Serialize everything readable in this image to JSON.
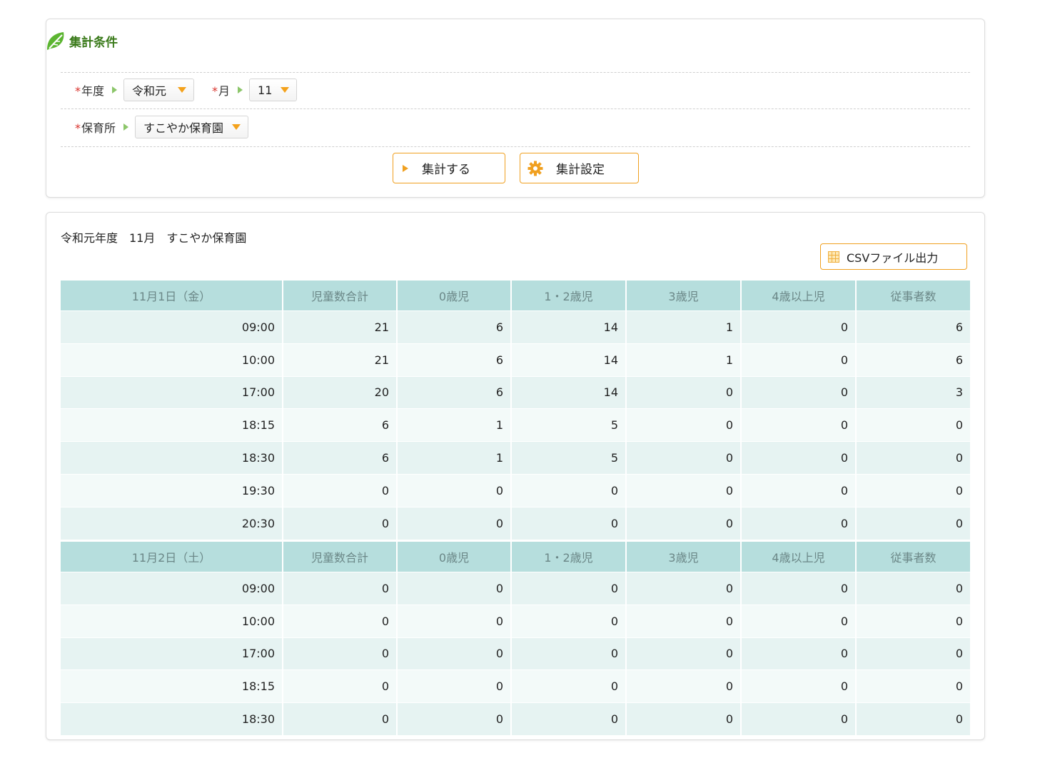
{
  "conditions": {
    "title": "集計条件",
    "year_label": "年度",
    "year_value": "令和元",
    "month_label": "月",
    "month_value": "11",
    "nursery_label": "保育所",
    "nursery_value": "すこやか保育園",
    "required_mark": "*",
    "aggregate_button": "集計する",
    "settings_button": "集計設定"
  },
  "result": {
    "summary": "令和元年度　11月　すこやか保育園",
    "csv_button": "CSVファイル出力",
    "columns": [
      "児童数合計",
      "0歳児",
      "1・2歳児",
      "3歳児",
      "4歳以上児",
      "従事者数"
    ],
    "days": [
      {
        "date": "11月1日（金）",
        "rows": [
          {
            "time": "09:00",
            "values": [
              "21",
              "6",
              "14",
              "1",
              "0",
              "6"
            ]
          },
          {
            "time": "10:00",
            "values": [
              "21",
              "6",
              "14",
              "1",
              "0",
              "6"
            ]
          },
          {
            "time": "17:00",
            "values": [
              "20",
              "6",
              "14",
              "0",
              "0",
              "3"
            ]
          },
          {
            "time": "18:15",
            "values": [
              "6",
              "1",
              "5",
              "0",
              "0",
              "0"
            ]
          },
          {
            "time": "18:30",
            "values": [
              "6",
              "1",
              "5",
              "0",
              "0",
              "0"
            ]
          },
          {
            "time": "19:30",
            "values": [
              "0",
              "0",
              "0",
              "0",
              "0",
              "0"
            ]
          },
          {
            "time": "20:30",
            "values": [
              "0",
              "0",
              "0",
              "0",
              "0",
              "0"
            ]
          }
        ]
      },
      {
        "date": "11月2日（土）",
        "rows": [
          {
            "time": "09:00",
            "values": [
              "0",
              "0",
              "0",
              "0",
              "0",
              "0"
            ]
          },
          {
            "time": "10:00",
            "values": [
              "0",
              "0",
              "0",
              "0",
              "0",
              "0"
            ]
          },
          {
            "time": "17:00",
            "values": [
              "0",
              "0",
              "0",
              "0",
              "0",
              "0"
            ]
          },
          {
            "time": "18:15",
            "values": [
              "0",
              "0",
              "0",
              "0",
              "0",
              "0"
            ]
          },
          {
            "time": "18:30",
            "values": [
              "0",
              "0",
              "0",
              "0",
              "0",
              "0"
            ]
          }
        ]
      }
    ]
  },
  "colors": {
    "header_bg": "#b6dedd",
    "row_odd": "#e6f3f2",
    "row_even": "#f3faf9",
    "accent_orange": "#f0a020",
    "title_green": "#3a7a1a",
    "required_red": "#d9302a"
  },
  "icons": {
    "title_icon": "leaf-icon",
    "settings_icon": "gear-icon",
    "csv_icon": "spreadsheet-icon",
    "dropdown_icon": "caret-down-icon",
    "label_arrow": "triangle-right-icon"
  }
}
